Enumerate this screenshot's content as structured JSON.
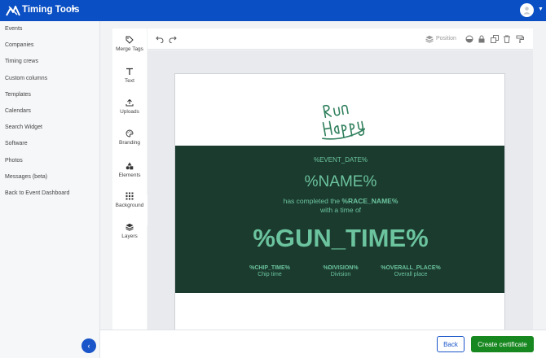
{
  "app": {
    "brand": "Timing Tools",
    "brand_caret": "▼",
    "avatar_caret": "▼",
    "colors": {
      "topbar": "#0a4fc4",
      "accent": "#1a56c9",
      "primary_button": "#17871f",
      "certificate_band": "#1b3b2f",
      "certificate_text": "#6cc49f"
    }
  },
  "sidebar": {
    "items": [
      {
        "label": "Events"
      },
      {
        "label": "Companies"
      },
      {
        "label": "Timing crews"
      },
      {
        "label": "Custom columns"
      },
      {
        "label": "Templates"
      },
      {
        "label": "Calendars"
      },
      {
        "label": "Search Widget"
      },
      {
        "label": "Software"
      },
      {
        "label": "Photos"
      },
      {
        "label": "Messages (beta)"
      },
      {
        "label": "Back to Event Dashboard"
      }
    ],
    "collapse_glyph": "‹"
  },
  "tools": [
    {
      "label": "Merge Tags",
      "icon": "tag-icon"
    },
    {
      "label": "Text",
      "icon": "text-icon"
    },
    {
      "label": "Uploads",
      "icon": "upload-icon"
    },
    {
      "label": "Branding",
      "icon": "palette-icon"
    },
    {
      "label": "Elements",
      "icon": "shapes-icon"
    },
    {
      "label": "Background",
      "icon": "grid-dots-icon"
    },
    {
      "label": "Layers",
      "icon": "layers-icon"
    }
  ],
  "toolbar": {
    "position_label": "Position",
    "icons": [
      "undo-icon",
      "redo-icon",
      "layers-icon",
      "opacity-icon",
      "lock-icon",
      "duplicate-icon",
      "delete-icon",
      "paint-roller-icon"
    ]
  },
  "certificate": {
    "logo_text": "Run Happy",
    "event_date": "%EVENT_DATE%",
    "name": "%NAME%",
    "line1_prefix": "has completed the ",
    "line1_race": "%RACE_NAME%",
    "line2": "with a time of",
    "gun_time": "%GUN_TIME%",
    "stats": [
      {
        "value": "%CHIP_TIME%",
        "label": "Chip time"
      },
      {
        "value": "%DIVISION%",
        "label": "Division"
      },
      {
        "value": "%OVERALL_PLACE%",
        "label": "Overall place"
      }
    ]
  },
  "footer": {
    "back_label": "Back",
    "create_label": "Create certificate"
  }
}
